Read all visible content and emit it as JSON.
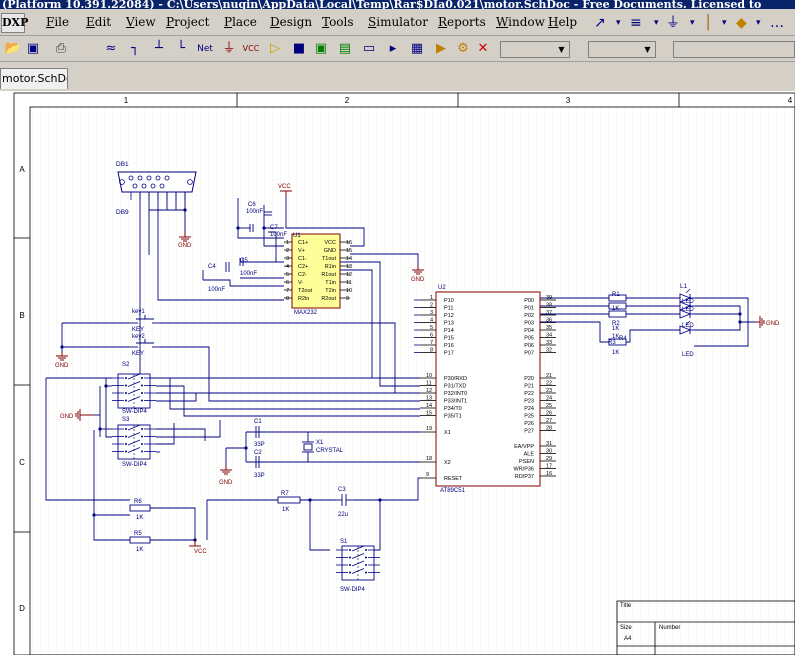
{
  "window": {
    "title": "(Platform 10.391.22084) - C:\\Users\\nuqin\\AppData\\Local\\Temp\\Rar$DIa0.021\\motor.SchDoc - Free Documents. Licensed to"
  },
  "menu": {
    "logo": "DXP",
    "items": [
      "File",
      "Edit",
      "View",
      "Project",
      "Place",
      "Design",
      "Tools",
      "Simulator",
      "Reports",
      "Window",
      "Help"
    ]
  },
  "document_tab": {
    "label": "motor.SchDoc"
  },
  "sheet": {
    "col_labels": [
      "1",
      "2",
      "3",
      "4"
    ],
    "row_labels": [
      "A",
      "B",
      "C",
      "D"
    ],
    "title_block": {
      "title": "Title",
      "size_label": "Size",
      "size_value": "A4",
      "number_label": "Number"
    }
  },
  "schematic": {
    "db1": {
      "ref": "DB1",
      "value": "DB9"
    },
    "u1": {
      "ref": "U1",
      "value": "MAX232",
      "left_pins": [
        "1",
        "2",
        "3",
        "4",
        "5",
        "6",
        "7",
        "8"
      ],
      "left_names": [
        "C1+",
        "V+",
        "C1-",
        "C2+",
        "C2-",
        "V-",
        "T2out",
        "R2in"
      ],
      "right_pins": [
        "16",
        "15",
        "14",
        "13",
        "12",
        "11",
        "10",
        "9"
      ],
      "right_names": [
        "VCC",
        "GND",
        "T1out",
        "R1in",
        "R1out",
        "T1in",
        "T2in",
        "R2out"
      ]
    },
    "u2": {
      "ref": "U2",
      "value": "AT89C51",
      "p1_pins": [
        "1",
        "2",
        "3",
        "4",
        "5",
        "6",
        "7",
        "8"
      ],
      "p1_names": [
        "P10",
        "P11",
        "P12",
        "P13",
        "P14",
        "P15",
        "P16",
        "P17"
      ],
      "p3_pins": [
        "10",
        "11",
        "12",
        "13",
        "14",
        "15"
      ],
      "p3_names": [
        "P30/RXD",
        "P31/TXD",
        "P32/INT0",
        "P33/INT1",
        "P34/T0",
        "P35/T1"
      ],
      "x1": {
        "pin": "19",
        "name": "X1"
      },
      "x2": {
        "pin": "18",
        "name": "X2"
      },
      "reset": {
        "pin": "9",
        "name": "RESET"
      },
      "p0_pins": [
        "39",
        "38",
        "37",
        "36",
        "35",
        "34",
        "33",
        "32"
      ],
      "p0_names": [
        "P00",
        "P01",
        "P02",
        "P03",
        "P04",
        "P05",
        "P06",
        "P07"
      ],
      "p2_pins": [
        "21",
        "22",
        "23",
        "24",
        "25",
        "26",
        "27",
        "28"
      ],
      "p2_names": [
        "P20",
        "P21",
        "P22",
        "P23",
        "P24",
        "P25",
        "P26",
        "P27"
      ],
      "ctrl_pins": [
        "31",
        "30",
        "29",
        "17",
        "16"
      ],
      "ctrl_names": [
        "EA/VPP",
        "ALE",
        "PSEN",
        "WR/P36",
        "RD/P37"
      ]
    },
    "caps": [
      {
        "ref": "C6",
        "value": "100nF"
      },
      {
        "ref": "C7",
        "value": "100nF"
      },
      {
        "ref": "C4",
        "value": "100nF"
      },
      {
        "ref": "C5",
        "value": "100nF"
      },
      {
        "ref": "C1",
        "value": "33P"
      },
      {
        "ref": "C2",
        "value": "33P"
      },
      {
        "ref": "C3",
        "value": "22u"
      }
    ],
    "crystal": {
      "ref": "X1",
      "value": "CRYSTAL"
    },
    "keys": [
      {
        "ref": "key1",
        "value": "KEY"
      },
      {
        "ref": "key2",
        "value": "KEY"
      }
    ],
    "switches": [
      {
        "ref": "S2",
        "value": "SW-DIP4"
      },
      {
        "ref": "S3",
        "value": "SW-DIP4"
      },
      {
        "ref": "S1",
        "value": "SW-DIP4"
      }
    ],
    "resistors": [
      {
        "ref": "R6",
        "value": "1K"
      },
      {
        "ref": "R5",
        "value": "1K"
      },
      {
        "ref": "R7",
        "value": "1K"
      }
    ],
    "led_resistors": [
      {
        "ref": "R1",
        "value": "1K"
      },
      {
        "ref": "R2",
        "value": "1K"
      },
      {
        "ref": "R3",
        "value": "1K"
      },
      {
        "ref": "R4",
        "value": "1K"
      }
    ],
    "leds": {
      "ref": "L1",
      "labels": [
        "LED",
        "LED",
        "LED",
        "LED"
      ]
    },
    "power": {
      "vcc": "VCC",
      "gnd": "GND"
    }
  },
  "colors": {
    "wire": "#000080",
    "component": "#800000",
    "pin_text": "#000000",
    "grid": "#f0ecd8",
    "body_fill": "#ffff99"
  }
}
